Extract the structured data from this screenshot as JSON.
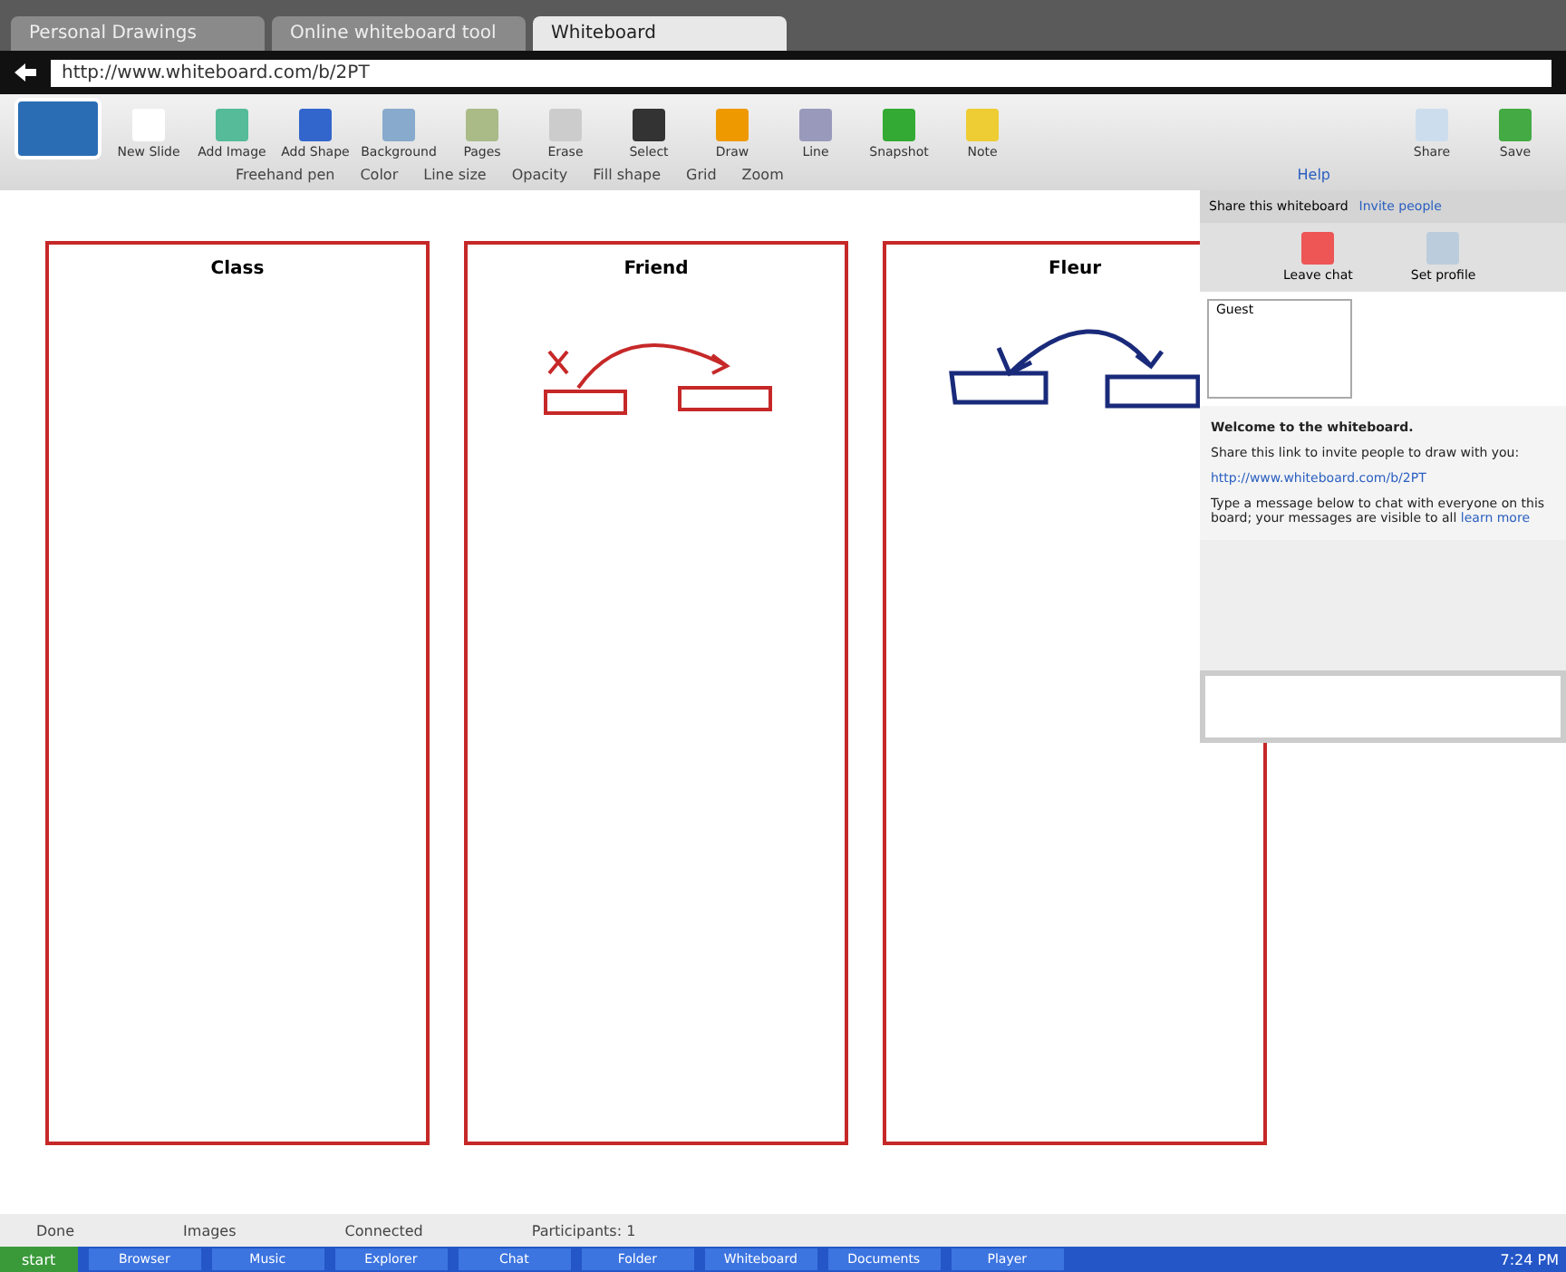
{
  "browser": {
    "tabs": [
      {
        "label": "Personal Drawings",
        "selected": false
      },
      {
        "label": "Online whiteboard tool",
        "selected": false
      },
      {
        "label": "Whiteboard",
        "selected": true
      }
    ],
    "address": "http://www.whiteboard.com/b/2PT"
  },
  "toolbar": {
    "tools": [
      {
        "label": "New Slide",
        "kind": "page"
      },
      {
        "label": "Add Image",
        "kind": "image"
      },
      {
        "label": "Add Shape",
        "kind": "shape"
      },
      {
        "label": "Background",
        "kind": "bg"
      },
      {
        "label": "Pages",
        "kind": "picture"
      },
      {
        "label": "Erase",
        "kind": "erase"
      },
      {
        "label": "Select",
        "kind": "select"
      },
      {
        "label": "Draw",
        "kind": "draw"
      },
      {
        "label": "Line",
        "kind": "line"
      },
      {
        "label": "Snapshot",
        "kind": "snap"
      },
      {
        "label": "Note",
        "kind": "note"
      }
    ],
    "right_tools": [
      {
        "label": "Share",
        "kind": "share"
      },
      {
        "label": "Save",
        "kind": "save"
      }
    ],
    "options": [
      {
        "label": "Freehand pen"
      },
      {
        "label": "Color"
      },
      {
        "label": "Line size"
      },
      {
        "label": "Opacity"
      },
      {
        "label": "Fill shape"
      },
      {
        "label": "Grid"
      },
      {
        "label": "Zoom"
      }
    ],
    "help": "Help"
  },
  "columns": [
    {
      "title": "Class",
      "kind": "empty"
    },
    {
      "title": "Friend",
      "kind": "crossed"
    },
    {
      "title": "Fleur",
      "kind": "swap"
    }
  ],
  "side_panel": {
    "header": "Share this whiteboard",
    "header_link": "Invite people",
    "actions": [
      {
        "label": "Leave chat"
      },
      {
        "label": "Set profile"
      }
    ],
    "users": [
      {
        "name": "Guest"
      }
    ],
    "notice_title": "Welcome to the whiteboard.",
    "notice_text": "Share this link to invite people to draw with you:",
    "notice_link": "http://www.whiteboard.com/b/2PT",
    "notice_text2": "Type a message below to chat with everyone on this board; your messages are visible to all",
    "notice_link2": "learn more"
  },
  "status_bar": [
    "Done",
    "Images",
    "Connected",
    "Participants: 1"
  ],
  "taskbar": {
    "start": "start",
    "items": [
      "Browser",
      "Music",
      "Explorer",
      "Chat",
      "Folder",
      "Whiteboard",
      "Documents",
      "Player"
    ],
    "clock": "7:24 PM"
  }
}
